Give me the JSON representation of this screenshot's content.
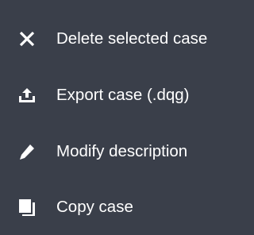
{
  "menu": {
    "background": "#3a3f4a",
    "text_color": "#ffffff",
    "items": [
      {
        "label": "Delete selected case",
        "icon": "close-icon"
      },
      {
        "label": "Export case (.dqg)",
        "icon": "export-icon"
      },
      {
        "label": "Modify description",
        "icon": "pencil-icon"
      },
      {
        "label": "Copy case",
        "icon": "copy-icon"
      }
    ]
  }
}
